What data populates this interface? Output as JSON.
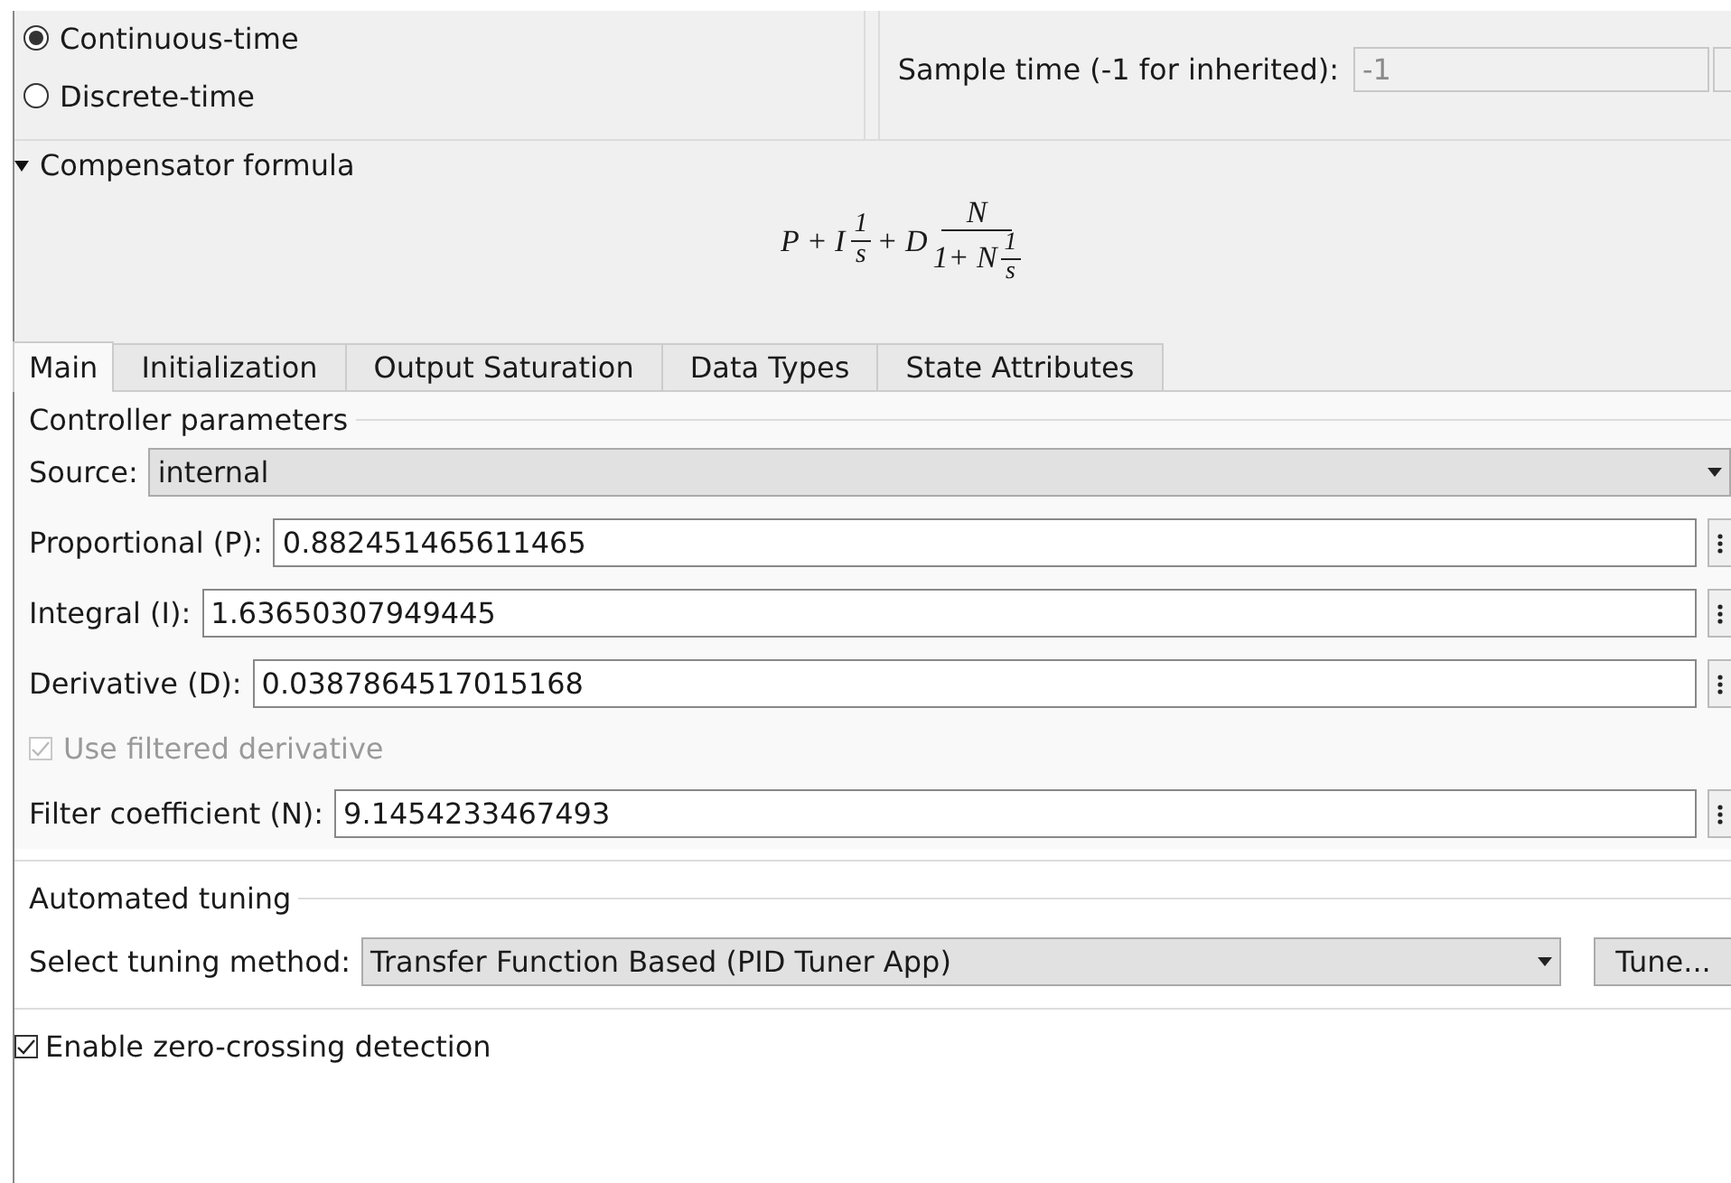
{
  "solver": {
    "options": [
      {
        "label": "Continuous-time",
        "selected": true
      },
      {
        "label": "Discrete-time",
        "selected": false
      }
    ]
  },
  "sample_time": {
    "label": "Sample time (-1 for inherited):",
    "value": "-1",
    "disabled": true
  },
  "compensator": {
    "label": "Compensator formula",
    "expanded": true,
    "formula": {
      "lead": "P + I",
      "frac1": {
        "num": "1",
        "den": "s"
      },
      "mid": "+ D",
      "frac2": {
        "num": "N",
        "den_lead": "1+ N",
        "den_frac": {
          "num": "1",
          "den": "s"
        }
      }
    }
  },
  "tabs": [
    {
      "label": "Main",
      "selected": true
    },
    {
      "label": "Initialization",
      "selected": false
    },
    {
      "label": "Output Saturation",
      "selected": false
    },
    {
      "label": "Data Types",
      "selected": false
    },
    {
      "label": "State Attributes",
      "selected": false
    }
  ],
  "controller_parameters": {
    "title": "Controller parameters",
    "rows": [
      {
        "kind": "dropdown",
        "label": "Source:",
        "value": "internal"
      },
      {
        "kind": "field",
        "label": "Proportional (P):",
        "value": "0.882451465611465"
      },
      {
        "kind": "field",
        "label": "Integral (I):",
        "value": "1.63650307949445"
      },
      {
        "kind": "field",
        "label": "Derivative (D):",
        "value": "0.0387864517015168"
      },
      {
        "kind": "checkbox",
        "label": "Use filtered derivative",
        "checked": true,
        "disabled": true
      },
      {
        "kind": "field",
        "label": "Filter coefficient (N):",
        "value": "9.1454233467493"
      }
    ]
  },
  "automated_tuning": {
    "title": "Automated tuning",
    "label": "Select tuning method:",
    "value": "Transfer Function Based (PID Tuner App)",
    "button": "Tune..."
  },
  "zero_crossing": {
    "label": "Enable zero-crossing detection",
    "checked": true
  }
}
